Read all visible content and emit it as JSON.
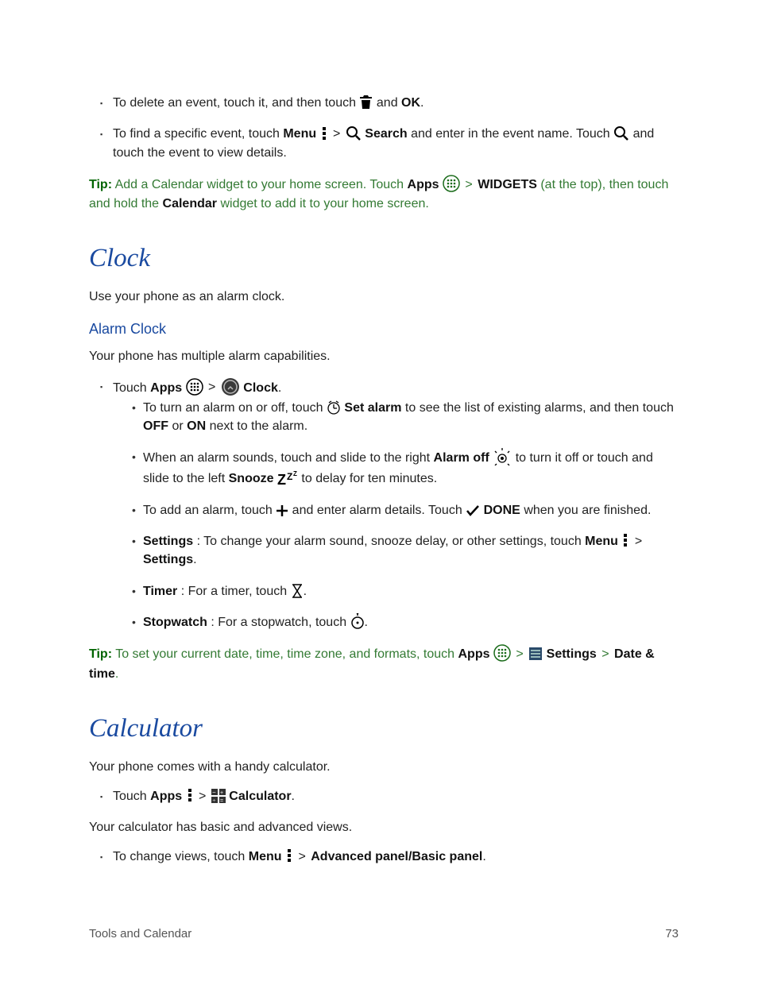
{
  "b1": {
    "a1": "To delete an event, touch it, and then touch ",
    "a2": " and ",
    "ok": "OK",
    "a3": "."
  },
  "b2": {
    "a1": "To find a specific event, touch ",
    "menu": "Menu",
    "a2": " > ",
    "search": "Search",
    "a3": " and enter in the event name. Touch ",
    "a4": " and touch the event to view details."
  },
  "tip1": {
    "label": "Tip:",
    "a1": " Add a Calendar widget to your home screen. Touch ",
    "apps": "Apps",
    "a2": " > ",
    "widgets": "WIDGETS",
    "a3": " (at the top), then touch and hold the ",
    "calendar": "Calendar",
    "a4": " widget to add it to your home screen."
  },
  "clock": {
    "title": "Clock",
    "intro": "Use your phone as an alarm clock.",
    "sub": "Alarm Clock",
    "sub_intro": "Your phone has multiple alarm capabilities."
  },
  "c1": {
    "a1": "Touch ",
    "apps": "Apps",
    "a2": " > ",
    "clock": "Clock",
    "a3": "."
  },
  "c2": {
    "a1": "To turn an alarm on or off, touch ",
    "setalarm": "Set alarm",
    "a2": " to see the list of existing alarms, and then touch ",
    "off": "OFF",
    "or": " or ",
    "on": "ON",
    "a3": " next to the alarm."
  },
  "c3": {
    "a1": "When an alarm sounds, touch and slide to the right ",
    "alarmoff": "Alarm off",
    "a2": " to turn it off or touch and slide to the left ",
    "snooze": "Snooze",
    "a3": " to delay for ten minutes."
  },
  "c4": {
    "a1": "To add an alarm, touch ",
    "a2": " and enter alarm details. Touch ",
    "done": "DONE",
    "a3": " when you are finished."
  },
  "c5": {
    "settings_lbl": "Settings",
    "a1": ": To change your alarm sound, snooze delay, or other settings, touch ",
    "menu": "Menu",
    "a2": " > ",
    "settings": "Settings",
    "a3": "."
  },
  "c6": {
    "timer_lbl": "Timer",
    "a1": ": For a timer, touch ",
    "a2": "."
  },
  "c7": {
    "stopwatch_lbl": "Stopwatch",
    "a1": ": For a stopwatch, touch ",
    "a2": "."
  },
  "tip2": {
    "label": "Tip:",
    "a1": " To set your current date, time, time zone, and formats, touch ",
    "apps": "Apps",
    "a2": " > ",
    "settings": "Settings",
    "a3": " > ",
    "datetime": "Date & time",
    "a4": "."
  },
  "calc": {
    "title": "Calculator",
    "intro": "Your phone comes with a handy calculator."
  },
  "k1": {
    "a1": "Touch ",
    "apps": "Apps",
    "a2": " > ",
    "calc": "Calculator",
    "a3": "."
  },
  "k_intro2": "Your calculator has basic and advanced views.",
  "k2": {
    "a1": "To change views, touch ",
    "menu": "Menu",
    "a2": " > ",
    "panel": "Advanced panel/Basic panel",
    "a3": "."
  },
  "footer": {
    "section": "Tools and Calendar",
    "page": "73"
  }
}
